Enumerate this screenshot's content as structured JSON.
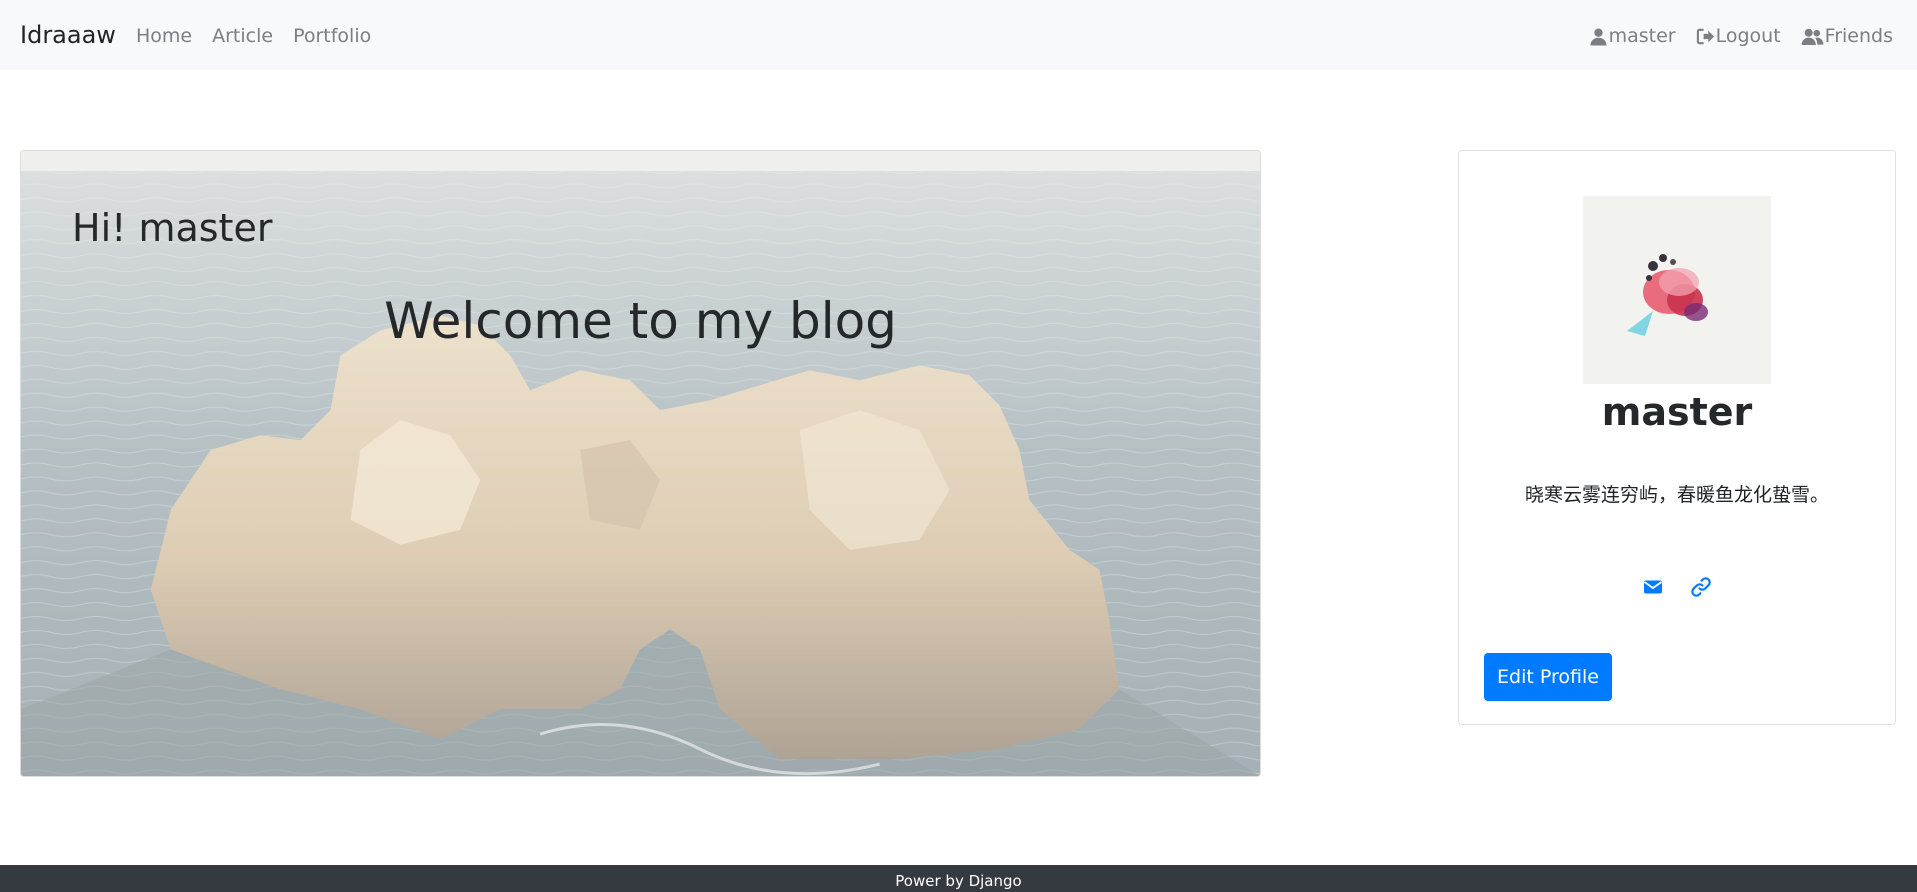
{
  "navbar": {
    "brand": "Idraaaw",
    "links": [
      {
        "label": "Home"
      },
      {
        "label": "Article"
      },
      {
        "label": "Portfolio"
      }
    ],
    "user": {
      "label": "master",
      "icon": "user-icon"
    },
    "logout": {
      "label": "Logout",
      "icon": "logout-icon"
    },
    "friends": {
      "label": "Friends",
      "icon": "friends-icon"
    }
  },
  "hero": {
    "greeting": "Hi! master",
    "welcome": "Welcome to my blog",
    "image": "sea-rock-background"
  },
  "profile": {
    "name": "master",
    "bio": "晓寒云雾连穷屿，春暖鱼龙化蛰雪。",
    "links": [
      {
        "icon": "envelope-icon"
      },
      {
        "icon": "link-icon"
      }
    ],
    "edit_label": "Edit Profile"
  },
  "footer": {
    "text": "Power by Django"
  },
  "colors": {
    "navbar_bg": "#f8f9fa",
    "accent": "#007bff",
    "footer_bg": "#343a40"
  }
}
